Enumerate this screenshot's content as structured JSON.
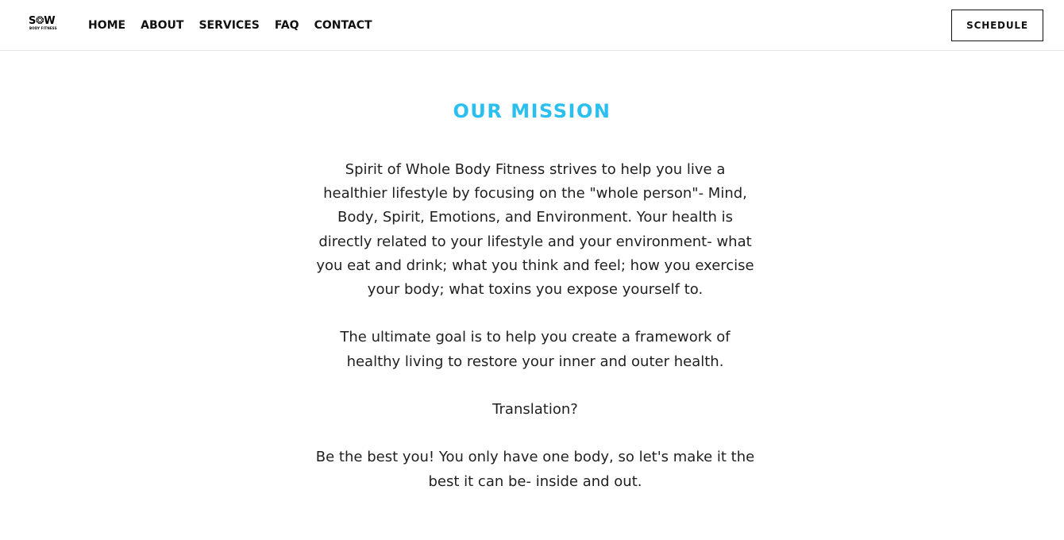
{
  "header": {
    "logo": {
      "main": "S❂W",
      "sub": "BODY FITNESS"
    },
    "nav": [
      {
        "label": "HOME"
      },
      {
        "label": "ABOUT"
      },
      {
        "label": "SERVICES"
      },
      {
        "label": "FAQ"
      },
      {
        "label": "CONTACT"
      }
    ],
    "schedule_label": "SCHEDULE"
  },
  "mission": {
    "title": "OUR MISSION",
    "paragraphs": [
      "Spirit of Whole Body Fitness strives to help you live a healthier lifestyle by focusing on the \"whole person\"- Mind, Body, Spirit, Emotions, and Environment. Your health is directly related to your lifestyle and your environment- what you eat and drink; what you think and feel; how you exercise your body; what toxins you expose yourself to.",
      "The ultimate goal is to help you create a framework of healthy living to restore your inner and outer health.",
      "Translation?",
      "Be the best you! You only have one body, so let's make it the best it can be- inside and out."
    ]
  },
  "colors": {
    "accent": "#2bbff0",
    "text": "#1f1f1f",
    "nav_text": "#111111",
    "divider": "#e6e6e6"
  }
}
